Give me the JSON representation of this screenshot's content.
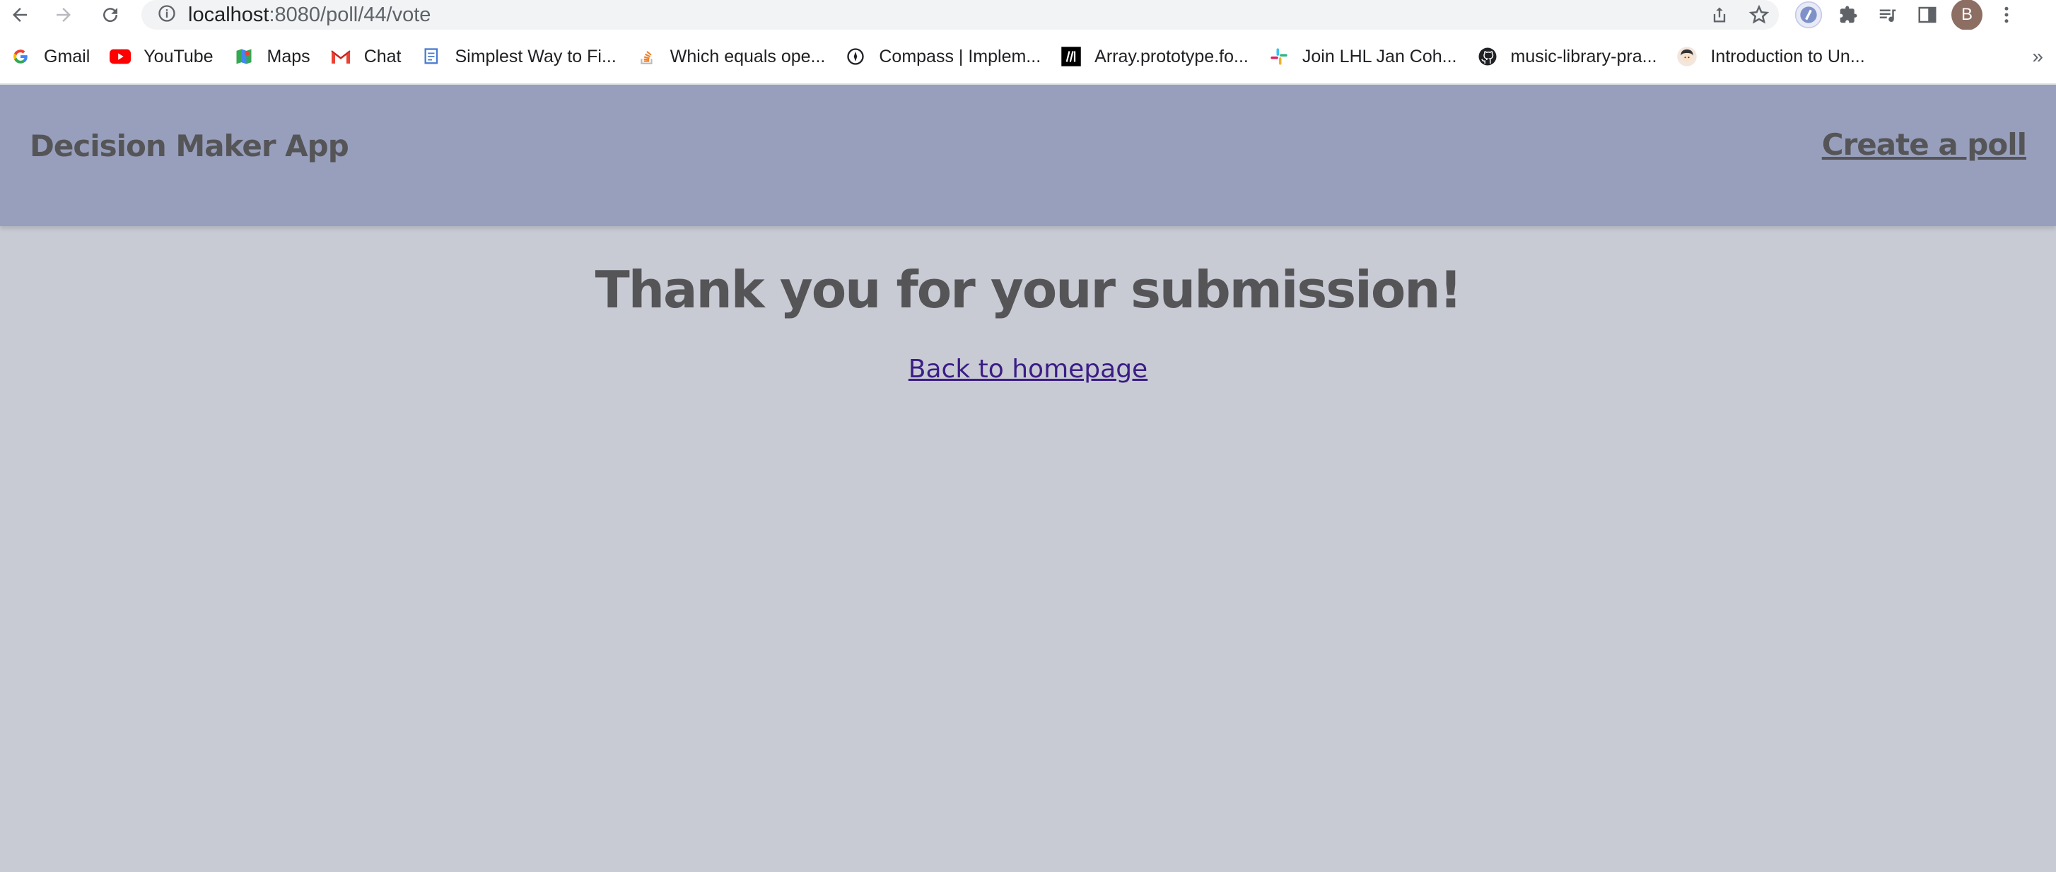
{
  "browser": {
    "url_host": "localhost",
    "url_rest": ":8080/poll/44/vote",
    "avatar_letter": "B",
    "bookmarks": [
      {
        "label": "Gmail",
        "icon": "google-icon"
      },
      {
        "label": "YouTube",
        "icon": "youtube-icon"
      },
      {
        "label": "Maps",
        "icon": "maps-icon"
      },
      {
        "label": "Chat",
        "icon": "gmail-icon"
      },
      {
        "label": "Simplest Way to Fi...",
        "icon": "doc-icon"
      },
      {
        "label": "Which equals ope...",
        "icon": "stackoverflow-icon"
      },
      {
        "label": "Compass | Implem...",
        "icon": "compass-icon"
      },
      {
        "label": "Array.prototype.fo...",
        "icon": "mdn-icon"
      },
      {
        "label": "Join LHL Jan Coh...",
        "icon": "slack-icon"
      },
      {
        "label": "music-library-pra...",
        "icon": "github-icon"
      },
      {
        "label": "Introduction to Un...",
        "icon": "avatar-icon"
      }
    ],
    "more_label": "»"
  },
  "header": {
    "brand": "Decision Maker App",
    "create_link": "Create a poll"
  },
  "main": {
    "heading": "Thank you for your submission!",
    "back_link": "Back to homepage"
  },
  "colors": {
    "header_bg": "#979fbc",
    "page_bg": "#c8cbd4",
    "text": "#555558",
    "link": "#3c1d86"
  }
}
